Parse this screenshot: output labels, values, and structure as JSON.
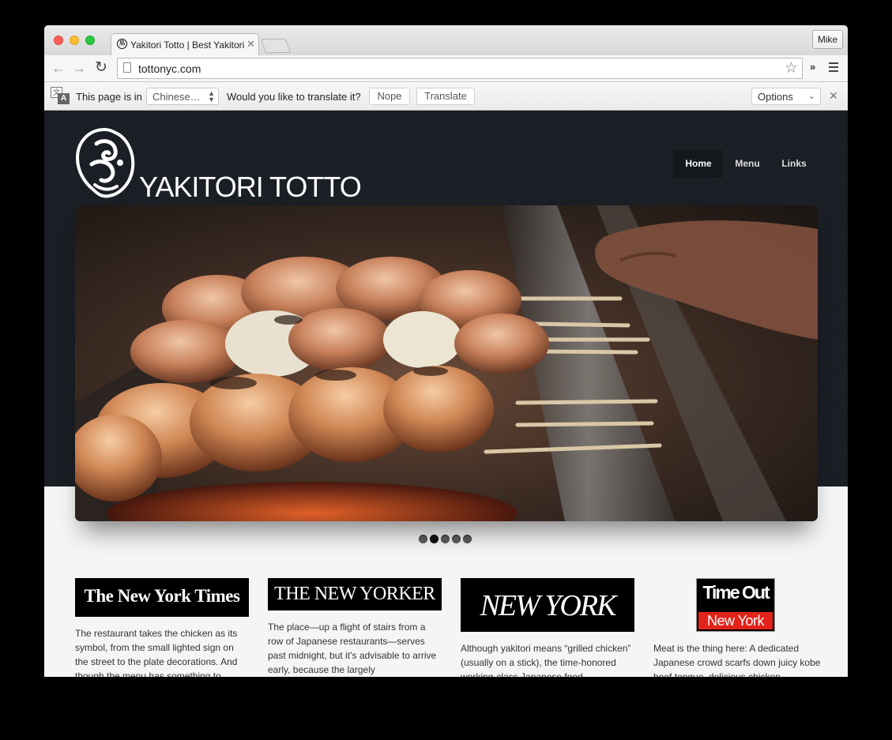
{
  "browser": {
    "tab_title": "Yakitori Totto | Best Yakitori i",
    "profile_name": "Mike",
    "url": "tottonyc.com"
  },
  "translate_bar": {
    "prefix": "This page is in",
    "language": "Chinese…",
    "question": "Would you like to translate it?",
    "nope_label": "Nope",
    "translate_label": "Translate",
    "options_label": "Options"
  },
  "site": {
    "title": "YAKITORI TOTTO",
    "nav": [
      {
        "label": "Home"
      },
      {
        "label": "Menu"
      },
      {
        "label": "Links"
      }
    ],
    "slideshow": {
      "slides": 5,
      "active_index": 1
    }
  },
  "press": [
    {
      "logo_text": "The New York Times",
      "text": "The restaurant takes the chicken as its symbol, from the small lighted sign on the street to the plate decorations. And though the menu has something to"
    },
    {
      "logo_text": "THE NEW YORKER",
      "text": "The place—up a flight of stairs from a row of Japanese restaurants—serves past midnight, but it’s advisable to arrive early, because the largely"
    },
    {
      "logo_text": "NEW YORK",
      "text": "Although yakitori means “grilled chicken” (usually on a stick), the time-honored working-class Japanese food"
    },
    {
      "logo_text_top": "Time Out",
      "logo_text_bottom": "New York",
      "text": "Meat is the thing here: A dedicated Japanese crowd scarfs down juicy kobe beef tongue, delicious chicken"
    }
  ],
  "colors": {
    "header_bg": "#1b1e24",
    "page_bg": "#f5f5f5",
    "timeout_red": "#e2231a"
  }
}
